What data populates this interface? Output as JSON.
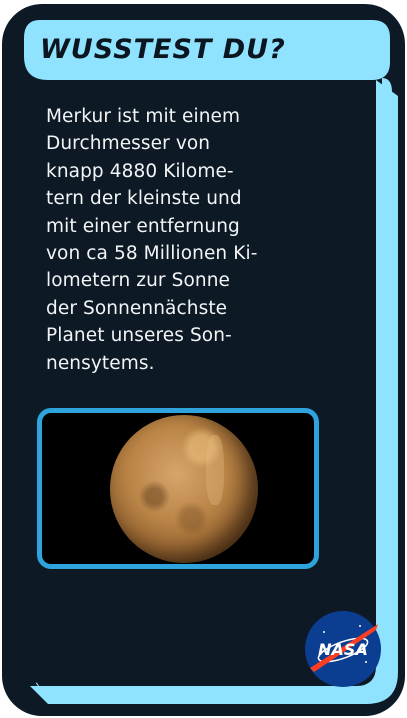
{
  "card": {
    "title": "WUSSTEST DU?",
    "text_lines": [
      "Merkur ist mit einem",
      "Durchmesser von",
      "knapp 4880 Kilome-",
      "tern der kleinste und",
      "mit einer entfernung",
      "von ca 58 Millionen Ki-",
      "lometern zur Sonne",
      "der Sonnennächste",
      "Planet unseres Son-",
      "nensytems."
    ],
    "image": "mercury-planet",
    "logo_text": "NASA",
    "colors": {
      "frame_light": "#8fe3ff",
      "frame_dark": "#0d1a26",
      "image_border": "#2ea3dc",
      "nasa_blue": "#0b3d91",
      "nasa_red": "#fc3d21"
    }
  }
}
